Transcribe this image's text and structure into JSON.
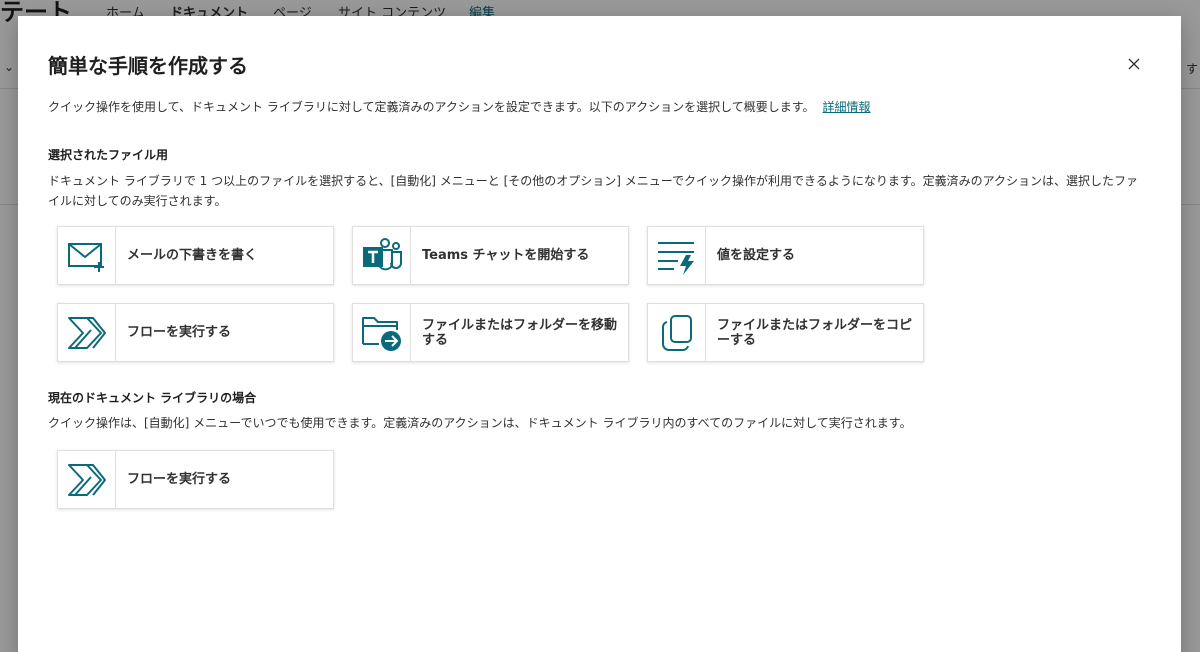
{
  "background": {
    "site_title": "テート",
    "nav": [
      "ホーム",
      "ドキュメント",
      "ページ",
      "サイト コンテンツ",
      "編集"
    ],
    "right_text": "す"
  },
  "dialog": {
    "title": "簡単な手順を作成する",
    "description": "クイック操作を使用して、ドキュメント ライブラリに対して定義済みのアクションを設定できます。以下のアクションを選択して概要します。",
    "learn_more": "詳細情報",
    "section1": {
      "title": "選択されたファイル用",
      "text": "ドキュメント ライブラリで 1 つ以上のファイルを選択すると、[自動化] メニューと [その他のオプション] メニューでクイック操作が利用できるようになります。定義済みのアクションは、選択したファイルに対してのみ実行されます。",
      "cards": [
        {
          "label": "メールの下書きを書く",
          "icon": "mail-add-icon"
        },
        {
          "label": "Teams チャットを開始する",
          "icon": "teams-icon"
        },
        {
          "label": "値を設定する",
          "icon": "set-value-icon"
        },
        {
          "label": "フローを実行する",
          "icon": "power-automate-icon"
        },
        {
          "label": "ファイルまたはフォルダーを移動する",
          "icon": "folder-move-icon"
        },
        {
          "label": "ファイルまたはフォルダーをコピーする",
          "icon": "copy-icon"
        }
      ]
    },
    "section2": {
      "title": "現在のドキュメント ライブラリの場合",
      "text": "クイック操作は、[自動化] メニューでいつでも使用できます。定義済みのアクションは、ドキュメント ライブラリ内のすべてのファイルに対して実行されます。",
      "cards": [
        {
          "label": "フローを実行する",
          "icon": "power-automate-icon"
        }
      ]
    }
  },
  "colors": {
    "accent": "#0b6a7a",
    "overlay": "rgba(0,0,0,0.40)"
  }
}
